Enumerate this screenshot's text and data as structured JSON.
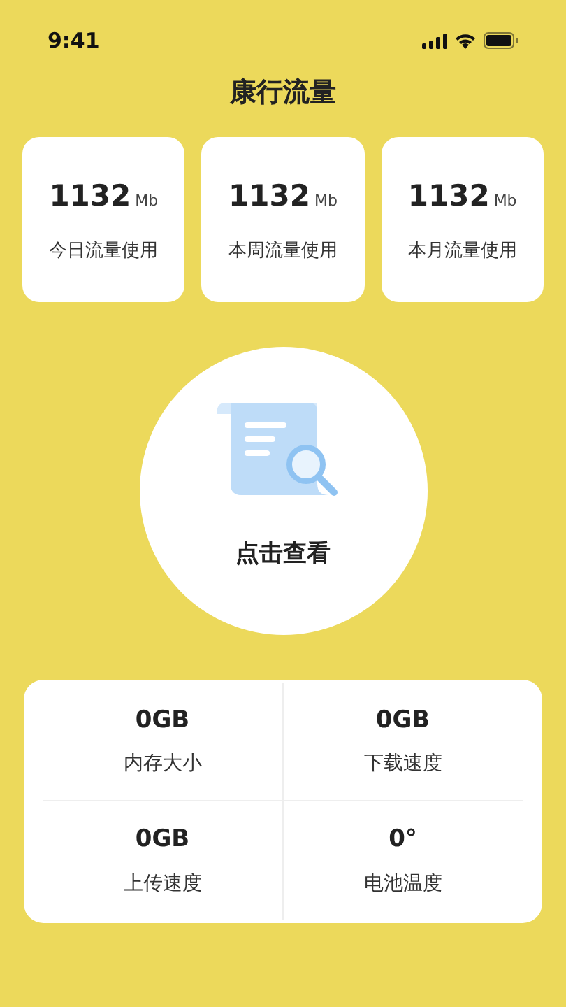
{
  "status_bar": {
    "time": "9:41"
  },
  "title": "康行流量",
  "usage_cards": [
    {
      "value": "1132",
      "unit": "Mb",
      "label": "今日流量使用"
    },
    {
      "value": "1132",
      "unit": "Mb",
      "label": "本周流量使用"
    },
    {
      "value": "1132",
      "unit": "Mb",
      "label": "本月流量使用"
    }
  ],
  "check_button": {
    "label": "点击查看"
  },
  "stats": [
    {
      "value": "0GB",
      "label": "内存大小"
    },
    {
      "value": "0GB",
      "label": "下载速度"
    },
    {
      "value": "0GB",
      "label": "上传速度"
    },
    {
      "value": "0°",
      "label": "电池温度"
    }
  ]
}
